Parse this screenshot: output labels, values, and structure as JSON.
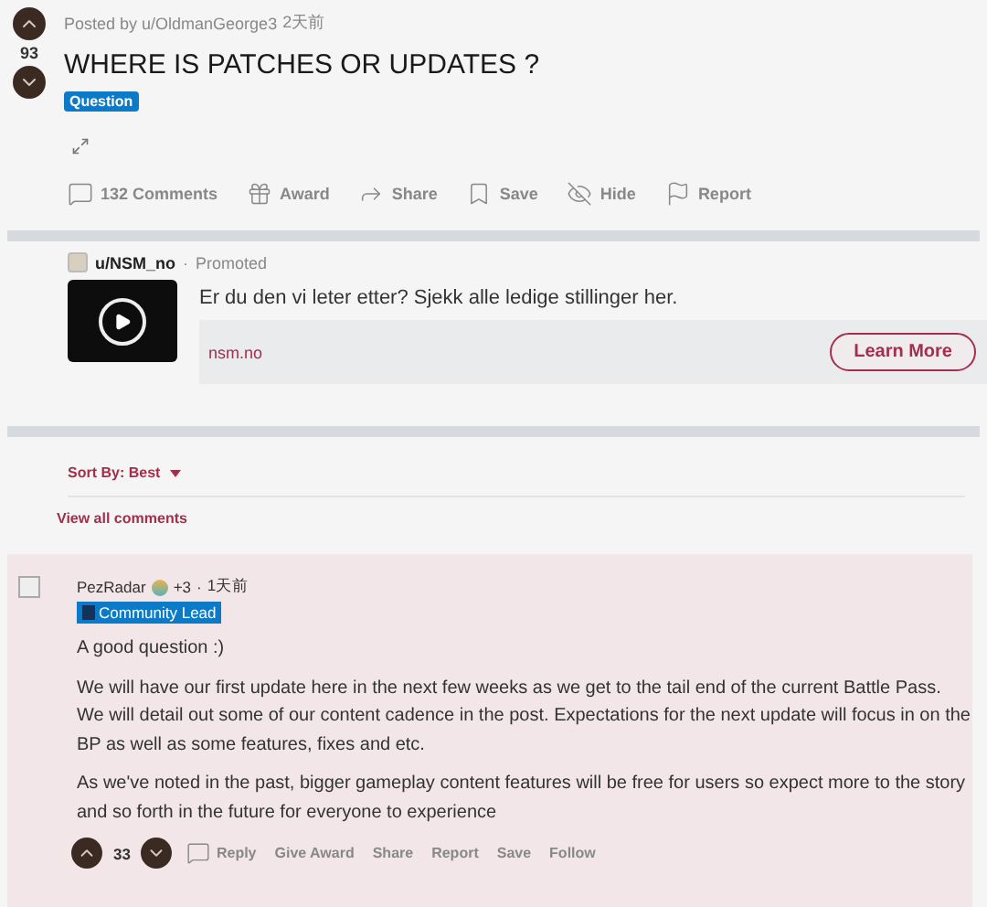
{
  "post": {
    "score": "93",
    "posted_by": "Posted by u/OldmanGeorge3",
    "time": "2天前",
    "title": "WHERE IS PATCHES OR UPDATES ?",
    "flair": "Question",
    "actions": [
      {
        "kind": "comment",
        "label": "132 Comments"
      },
      {
        "kind": "award",
        "label": "Award"
      },
      {
        "kind": "share",
        "label": "Share"
      },
      {
        "kind": "save",
        "label": "Save"
      },
      {
        "kind": "hide",
        "label": "Hide"
      },
      {
        "kind": "report",
        "label": "Report"
      }
    ]
  },
  "ad": {
    "user": "u/NSM_no",
    "separator": "·",
    "tag": "Promoted",
    "text": "Er du den vi leter etter? Sjekk alle ledige stillinger her.",
    "domain": "nsm.no",
    "button": "Learn More"
  },
  "sort": {
    "label": "Sort By: Best"
  },
  "view_all": "View all comments",
  "comment": {
    "author": "PezRadar",
    "extra": "+3",
    "separator": "·",
    "time": "1天前",
    "flair": "Community Lead",
    "paragraphs": [
      "A good question :)",
      "We will have our first update here in the next few weeks as we get to the tail end of the current Battle Pass. We will detail out some of our content cadence in the post. Expectations for the next update will focus in on the BP as well as some features, fixes and etc.",
      "As we've noted in the past, bigger gameplay content features will be free for users so expect more to the story and so forth in the future for everyone to experience"
    ],
    "score": "33",
    "actions": [
      {
        "kind": "reply",
        "label": "Reply"
      },
      {
        "kind": "text",
        "label": "Give Award"
      },
      {
        "kind": "text",
        "label": "Share"
      },
      {
        "kind": "text",
        "label": "Report"
      },
      {
        "kind": "text",
        "label": "Save"
      },
      {
        "kind": "text",
        "label": "Follow"
      }
    ]
  }
}
